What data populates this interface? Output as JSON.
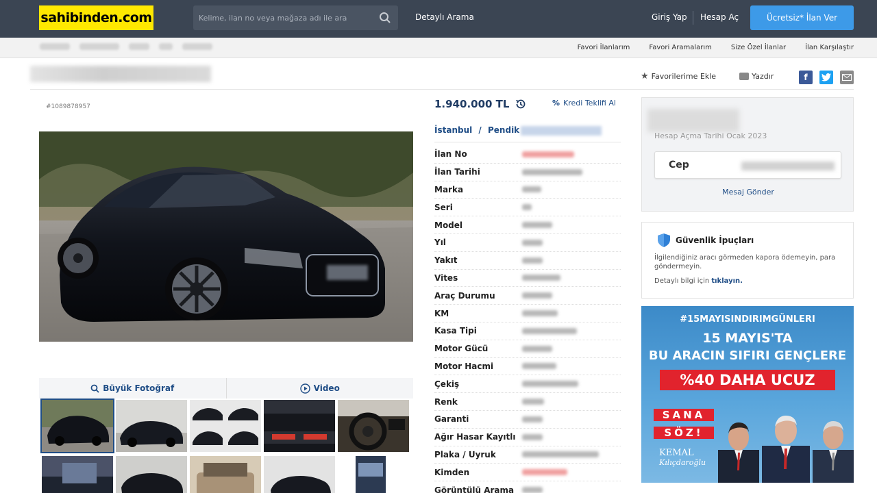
{
  "header": {
    "logo": "sahibinden.com",
    "search_placeholder": "Kelime, ilan no veya mağaza adı ile ara",
    "detailed_search": "Detaylı Arama",
    "login": "Giriş Yap",
    "signup": "Hesap Aç",
    "post_ad": "Ücretsiz* İlan Ver"
  },
  "subnav": {
    "links": [
      "Favori İlanlarım",
      "Favori Aramalarım",
      "Size Özel İlanlar",
      "İlan Karşılaştır"
    ]
  },
  "actions": {
    "favorite": "Favorilerime Ekle",
    "print": "Yazdır"
  },
  "listing": {
    "number": "#1089878957",
    "price": "1.940.000 TL",
    "credit": "Kredi Teklifi Al",
    "city": "İstanbul",
    "district": "Pendik",
    "location_sep": "/"
  },
  "photo_tabs": {
    "big_photo": "Büyük Fotoğraf",
    "video": "Video"
  },
  "specs": [
    {
      "label": "İlan No"
    },
    {
      "label": "İlan Tarihi"
    },
    {
      "label": "Marka"
    },
    {
      "label": "Seri"
    },
    {
      "label": "Model"
    },
    {
      "label": "Yıl"
    },
    {
      "label": "Yakıt"
    },
    {
      "label": "Vites"
    },
    {
      "label": "Araç Durumu"
    },
    {
      "label": "KM"
    },
    {
      "label": "Kasa Tipi"
    },
    {
      "label": "Motor Gücü"
    },
    {
      "label": "Motor Hacmi"
    },
    {
      "label": "Çekiş"
    },
    {
      "label": "Renk"
    },
    {
      "label": "Garanti"
    },
    {
      "label": "Ağır Hasar Kayıtlı"
    },
    {
      "label": "Plaka / Uyruk"
    },
    {
      "label": "Kimden"
    },
    {
      "label": "Görüntülü Arama"
    }
  ],
  "seller": {
    "member_since": "Hesap Açma Tarihi  Ocak 2023",
    "phone_label": "Cep",
    "send_message": "Mesaj Gönder"
  },
  "safety": {
    "title": "Güvenlik İpuçları",
    "text": "İlgilendiğiniz aracı görmeden kapora ödemeyin, para göndermeyin.",
    "more_prefix": "Detaylı bilgi için ",
    "more_link": "tıklayın."
  },
  "ad": {
    "hashtag": "#15MAYISINDIRIMGÜNLERI",
    "line1": "15 MAYIS'TA",
    "line2": "BU ARACIN SIFIRI GENÇLERE",
    "banner": "%40 DAHA UCUZ",
    "sana": "SANA",
    "soz": "SÖZ!",
    "sign_line1": "KEMAL",
    "sign_line2": "Kılıçdaroğlu"
  },
  "colors": {
    "header_bg": "#3b4553",
    "logo_bg": "#ffe800",
    "accent_blue": "#3d9ae8",
    "link_blue": "#1f4d86",
    "ad_red": "#e1232d"
  }
}
